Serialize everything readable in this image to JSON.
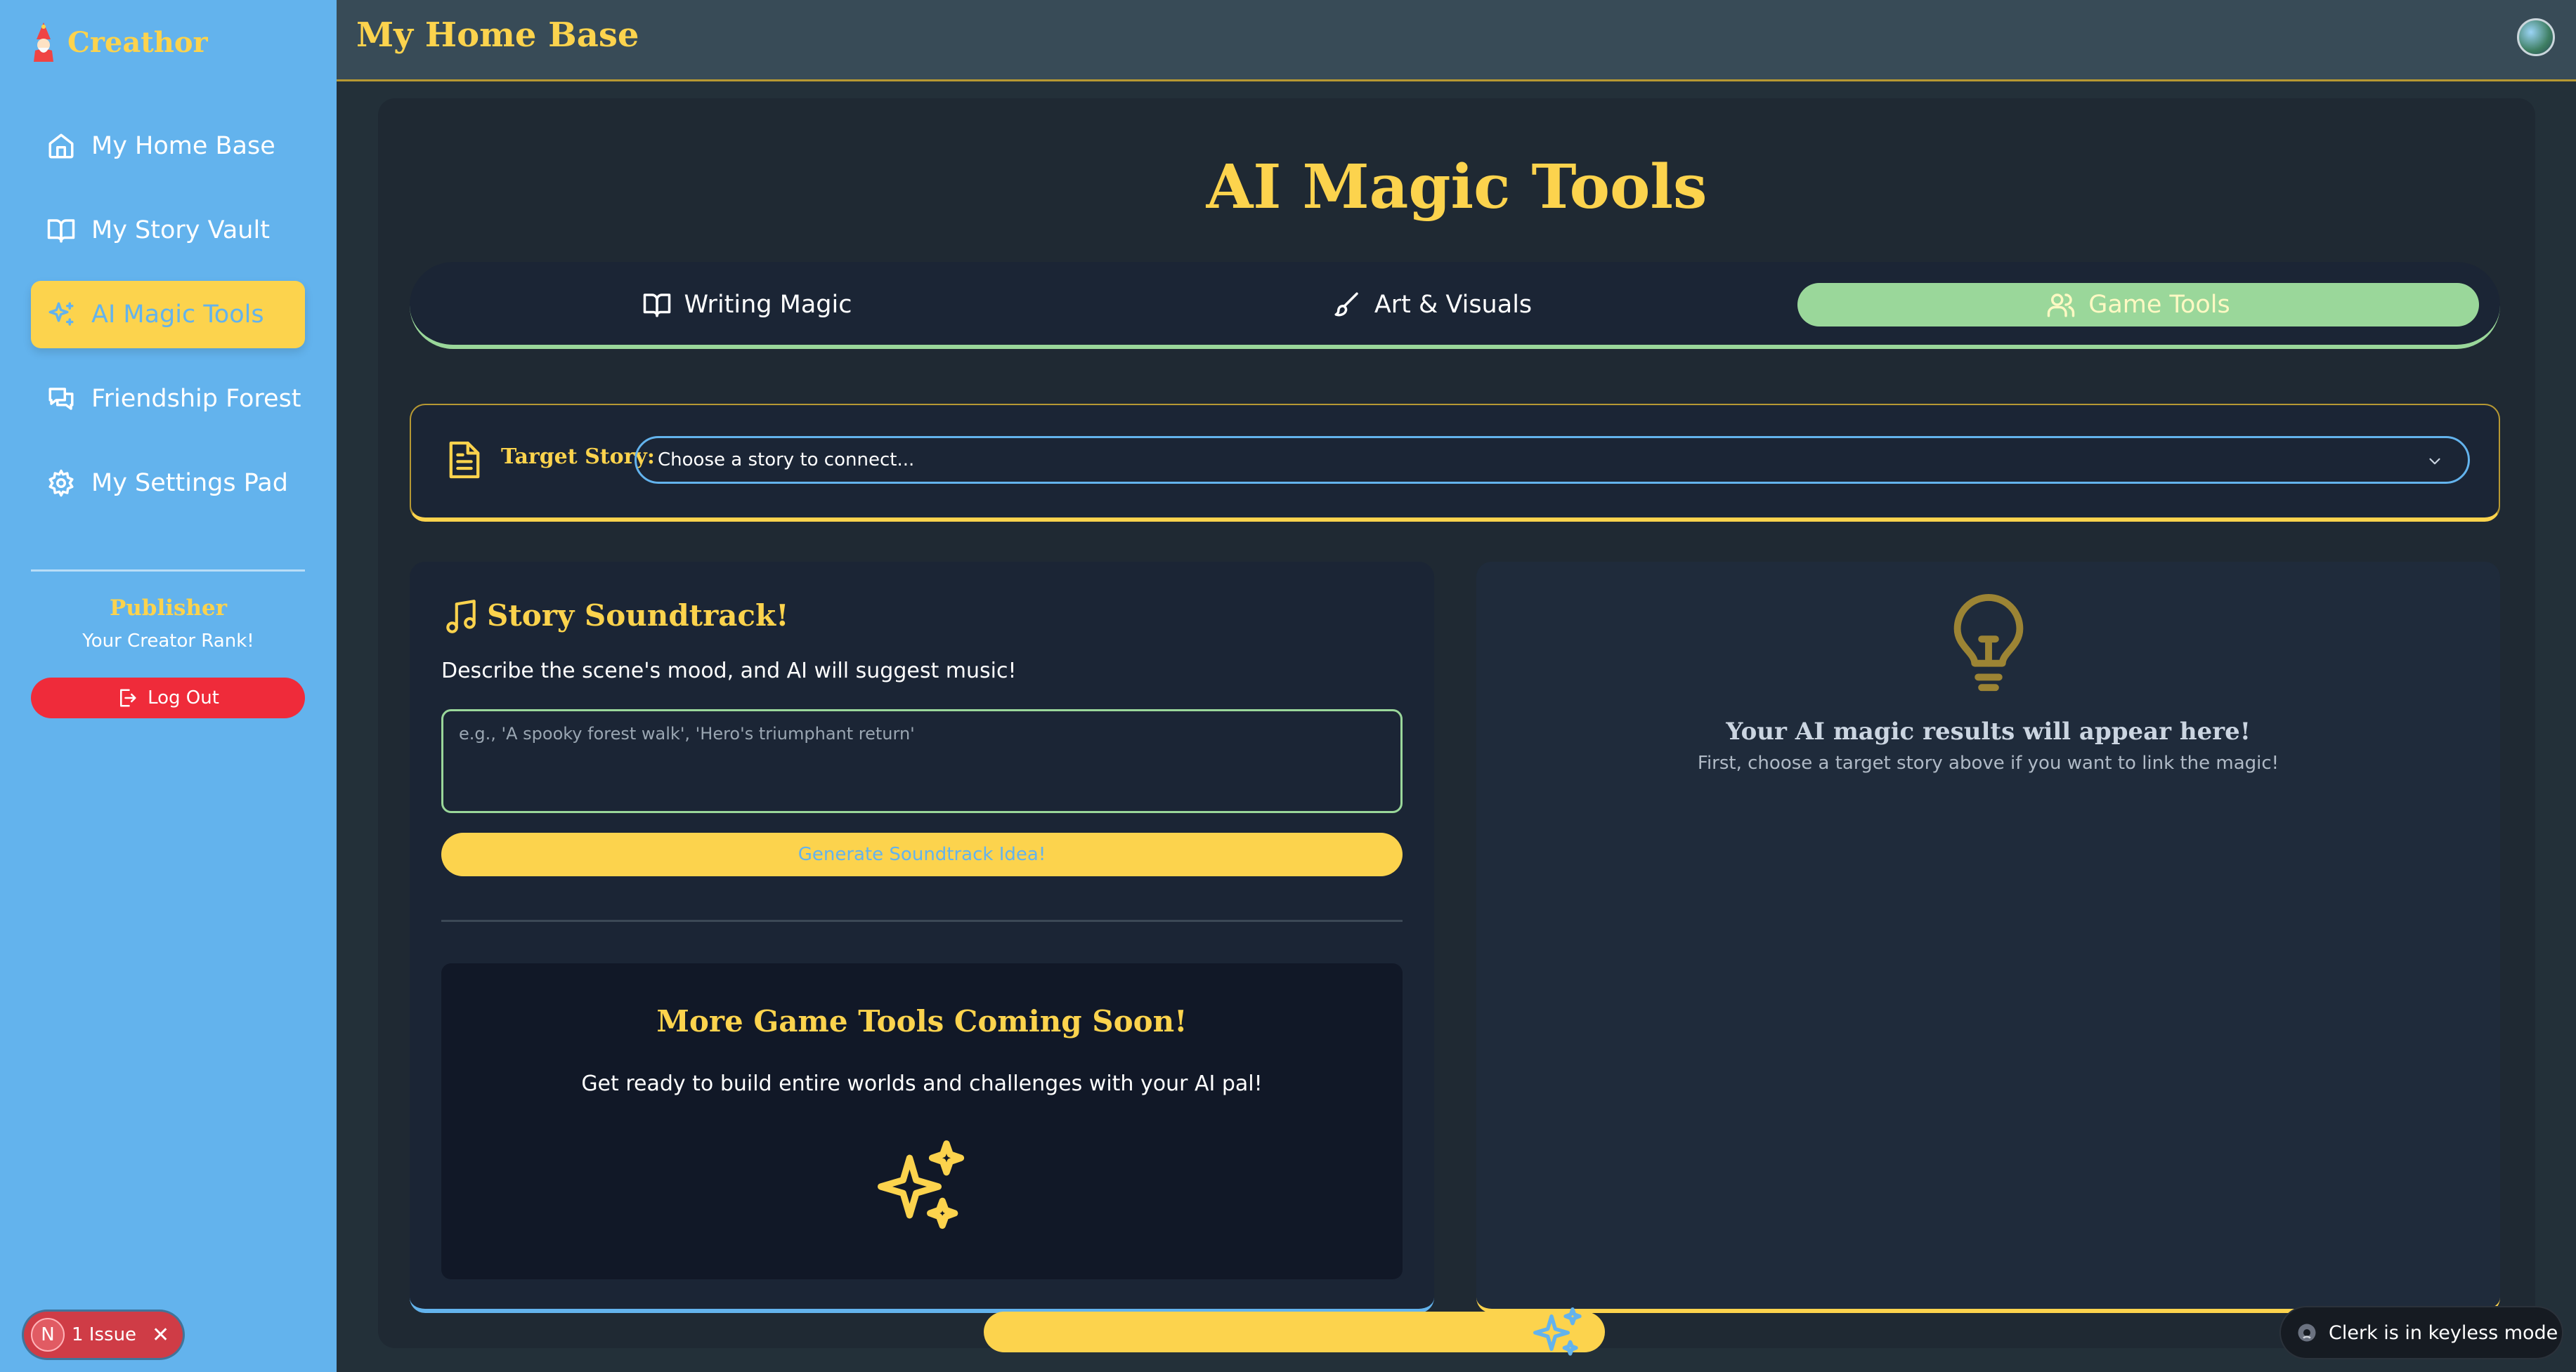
{
  "brand": {
    "name": "Creathor"
  },
  "header": {
    "title": "My Home Base"
  },
  "sidebar": {
    "items": [
      {
        "label": "My Home Base",
        "icon": "home-icon"
      },
      {
        "label": "My Story Vault",
        "icon": "book-icon"
      },
      {
        "label": "AI Magic Tools",
        "icon": "sparkles-icon",
        "active": true
      },
      {
        "label": "Friendship Forest",
        "icon": "chat-icon"
      },
      {
        "label": "My Settings Pad",
        "icon": "gear-icon"
      }
    ],
    "rank_title": "Publisher",
    "rank_subtitle": "Your Creator Rank!",
    "logout_label": "Log Out"
  },
  "main": {
    "title": "AI Magic Tools",
    "tabs": [
      {
        "label": "Writing Magic",
        "icon": "book-icon"
      },
      {
        "label": "Art & Visuals",
        "icon": "brush-icon"
      },
      {
        "label": "Game Tools",
        "icon": "users-icon",
        "active": true
      }
    ],
    "target": {
      "label": "Target Story:",
      "select_value": "Choose a story to connect..."
    },
    "soundtrack": {
      "title": "Story Soundtrack!",
      "description": "Describe the scene's mood, and AI will suggest music!",
      "placeholder": "e.g., 'A spooky forest walk', 'Hero's triumphant return'",
      "button_label": "Generate Soundtrack Idea!"
    },
    "coming_soon": {
      "title": "More Game Tools Coming Soon!",
      "description": "Get ready to build entire worlds and challenges with your AI pal!"
    },
    "results": {
      "title": "Your AI magic results will appear here!",
      "subtitle": "First, choose a target story above if you want to link the magic!"
    }
  },
  "dev": {
    "issue_badge": "N",
    "issue_label": "1 Issue",
    "issue_close": "✕",
    "clerk_label": "Clerk is in keyless mode"
  },
  "colors": {
    "sidebar": "#63b3ed",
    "accent": "#fcd34d",
    "active_tab": "#9ad79a",
    "logout": "#ef2b3a"
  }
}
